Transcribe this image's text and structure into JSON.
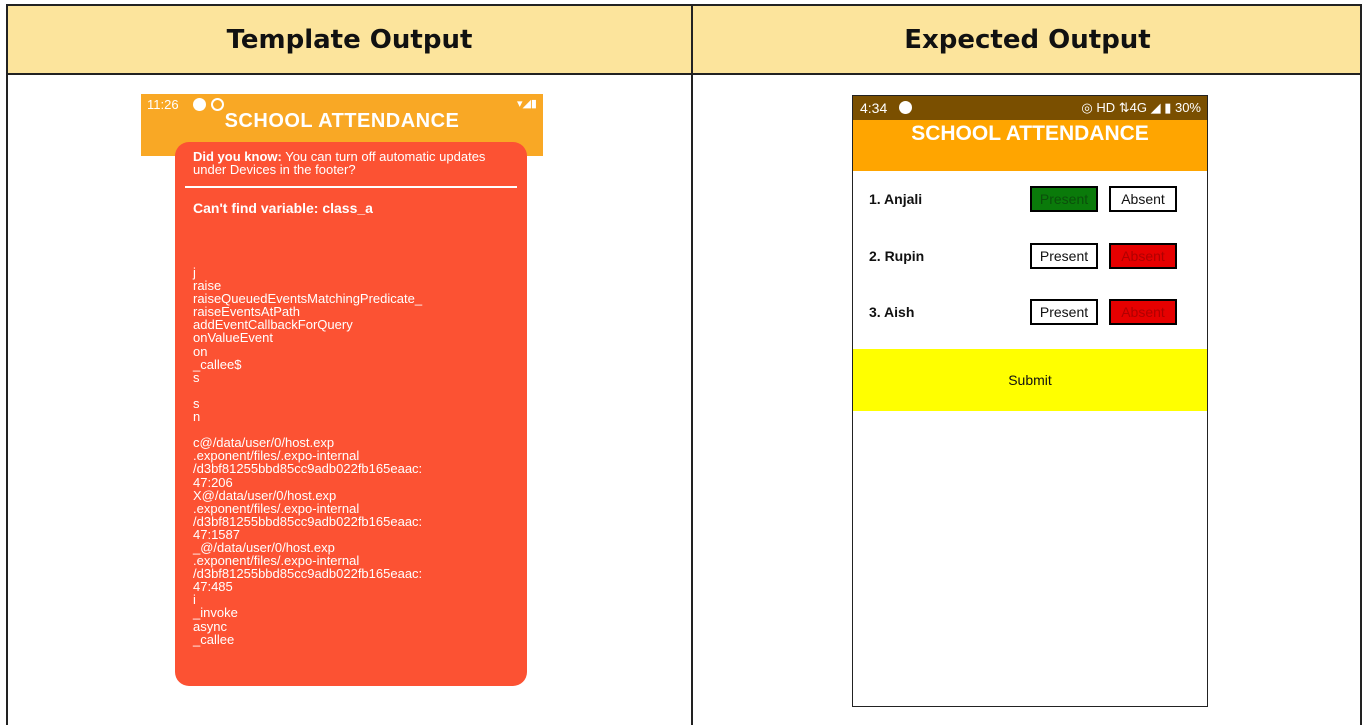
{
  "headers": {
    "left": "Template Output",
    "right": "Expected Output"
  },
  "template_output": {
    "status_time": "11:26",
    "status_signal": "▾◢▮",
    "title": "SCHOOL ATTENDANCE",
    "tip_label": "Did you know:",
    "tip_text": " You can turn off automatic updates under Devices in the footer?",
    "error_title": "Can't find variable: class_a",
    "stack_trace": "j\nraise\nraiseQueuedEventsMatchingPredicate_\nraiseEventsAtPath\naddEventCallbackForQuery\nonValueEvent\non\n_callee$\ns\n\ns\nn\n\nc@/data/user/0/host.exp\n.exponent/files/.expo-internal\n/d3bf81255bbd85cc9adb022fb165eaac:\n47:206\nX@/data/user/0/host.exp\n.exponent/files/.expo-internal\n/d3bf81255bbd85cc9adb022fb165eaac:\n47:1587\n_@/data/user/0/host.exp\n.exponent/files/.expo-internal\n/d3bf81255bbd85cc9adb022fb165eaac:\n47:485\ni\n_invoke\nasync\n_callee"
  },
  "expected_output": {
    "status_time": "4:34",
    "status_right": "◎ HD ⇅4G ◢ ▮ 30%",
    "title": "SCHOOL ATTENDANCE",
    "students": [
      {
        "name": "1.  Anjali",
        "present_label": "Present",
        "absent_label": "Absent",
        "selected": "present"
      },
      {
        "name": "2.  Rupin",
        "present_label": "Present",
        "absent_label": "Absent",
        "selected": "absent"
      },
      {
        "name": "3.  Aish",
        "present_label": "Present",
        "absent_label": "Absent",
        "selected": "absent"
      }
    ],
    "submit_label": "Submit"
  },
  "colors": {
    "header_bg": "#fce49c",
    "left_appbar": "#f9a825",
    "error_box": "#fc5233",
    "right_statusbar": "#7a4f00",
    "right_appbar": "#ffa500",
    "present_selected": "#0a7a0a",
    "absent_selected": "#e60000",
    "submit_bg": "#ffff00"
  }
}
